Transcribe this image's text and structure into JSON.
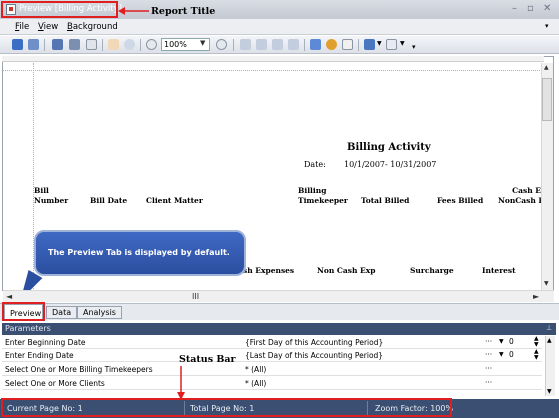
{
  "window": {
    "title": "Preview [Billing Activity]",
    "minimize_glyph": "–",
    "restore_glyph": "▫",
    "close_glyph": "✕"
  },
  "annotations": {
    "report_title": "Report Title",
    "status_bar": "Status Bar",
    "tooltip": "The Preview Tab is displayed by default."
  },
  "menu": {
    "items": [
      {
        "label": "File",
        "accel": "F",
        "rest": "ile"
      },
      {
        "label": "View",
        "accel": "V",
        "rest": "iew"
      },
      {
        "label": "Background",
        "accel": "B",
        "rest": "ackground"
      }
    ]
  },
  "toolbar": {
    "zoom": "100%",
    "icons": [
      "refresh-icon",
      "refresh-alt-icon",
      "first-page-icon",
      "previous-icon",
      "page-setup-icon",
      "hand-tool-icon",
      "magnifier-icon",
      "zoom-out-icon",
      "zoom-in-icon",
      "first-page-nav-icon",
      "prev-page-nav-icon",
      "next-page-nav-icon",
      "last-page-nav-icon",
      "multi-page-icon",
      "color-icon",
      "watermark-icon",
      "export-icon",
      "email-icon"
    ]
  },
  "report": {
    "title": "Billing Activity",
    "date_label": "Date:",
    "date_range": "10/1/2007-   10/31/2007",
    "headers": {
      "bill_number_1": "Bill",
      "bill_number_2": "Number",
      "bill_date": "Bill Date",
      "client_matter": "Client Matter",
      "billing_tk_1": "Billing",
      "billing_tk_2": "Timekeeper",
      "total_billed": "Total Billed",
      "fees_billed": "Fees Billed",
      "cash_1": "Cash E",
      "cash_2": "NonCash E",
      "cash_expenses": "sh Expenses",
      "non_cash_exp": "Non Cash Exp",
      "surcharge": "Surcharge",
      "interest": "Interest"
    }
  },
  "scrollbars": {
    "h_glyph": "III",
    "left_arrow": "◄",
    "right_arrow": "►",
    "up_arrow": "▲",
    "down_arrow": "▼"
  },
  "tabs": [
    {
      "label": "Preview",
      "active": true
    },
    {
      "label": "Data",
      "active": false
    },
    {
      "label": "Analysis",
      "active": false
    }
  ],
  "parameters": {
    "header": "Parameters",
    "pin_glyph": "⊥",
    "rows": [
      {
        "label": "Enter Beginning Date",
        "value": "{First Day of this Accounting Period}",
        "dots": "···",
        "extra": "0"
      },
      {
        "label": "Enter Ending Date",
        "value": "{Last Day of this Accounting Period}",
        "dots": "···",
        "extra": "0"
      },
      {
        "label": "Select One or More Billing Timekeepers",
        "value": "* (All)",
        "dots": "···",
        "extra": ""
      },
      {
        "label": "Select One or More Clients",
        "value": "* (All)",
        "dots": "···",
        "extra": ""
      }
    ]
  },
  "status": {
    "current_page": "Current Page No: 1",
    "total_page": "Total Page No: 1",
    "zoom_factor": "Zoom Factor: 100%"
  },
  "colors": {
    "annotation_red": "#e02020",
    "status_bg": "#3a4f71",
    "tooltip_blue": "#2b4fa0"
  }
}
